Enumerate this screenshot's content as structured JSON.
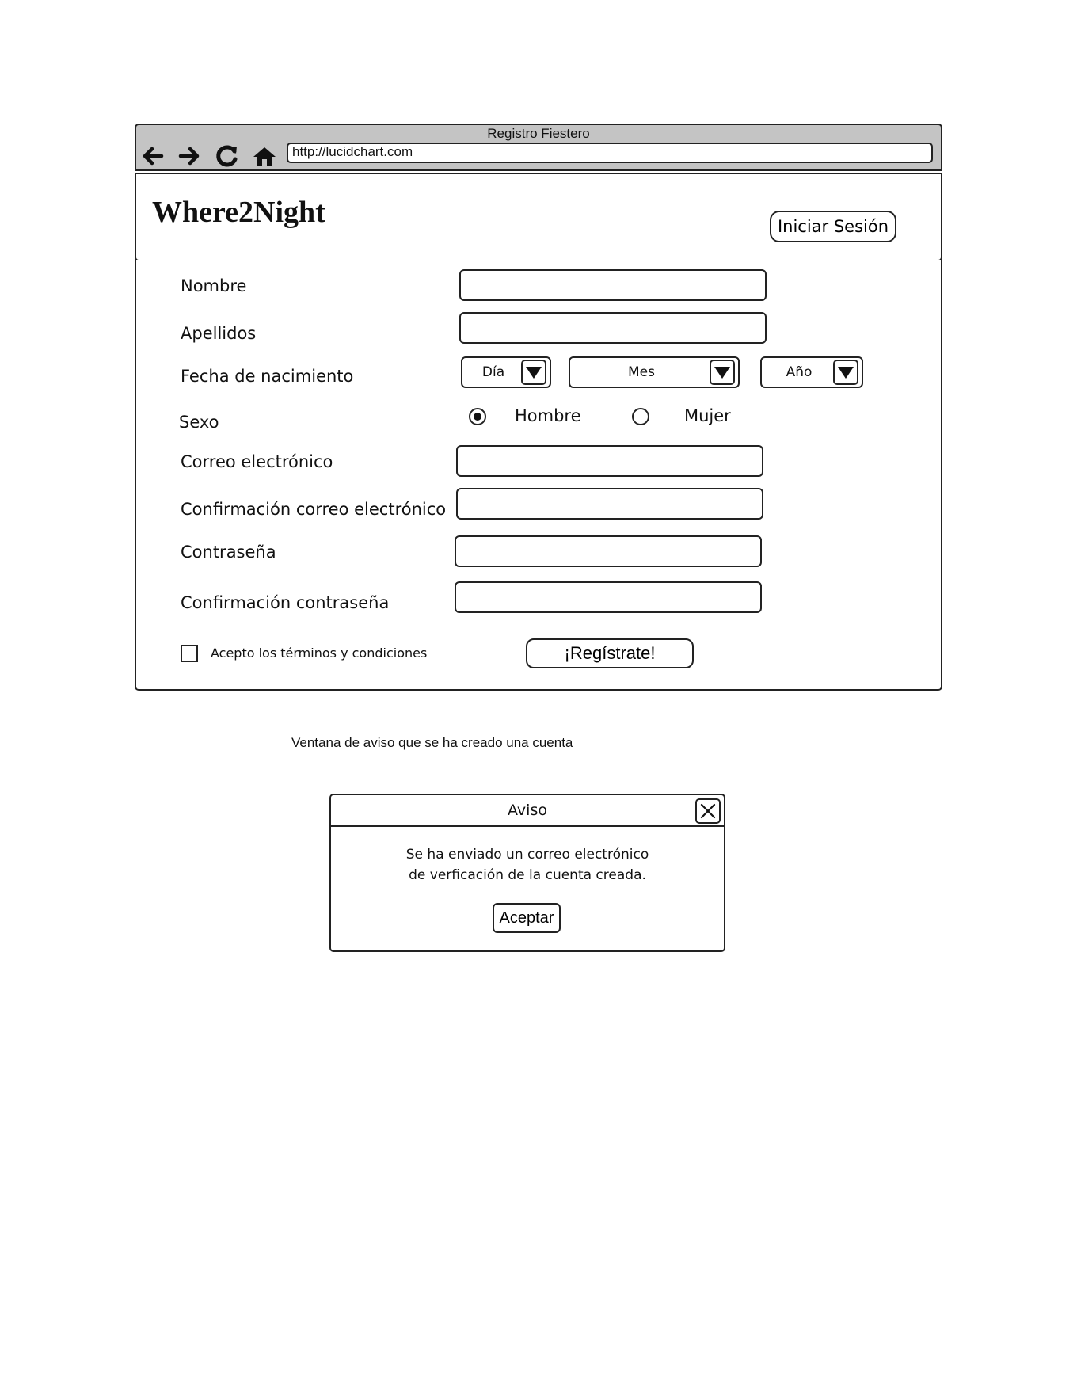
{
  "browser": {
    "window_title": "Registro Fiestero",
    "url": "http://lucidchart.com",
    "icons": [
      "back-arrow-icon",
      "forward-arrow-icon",
      "reload-icon",
      "home-icon"
    ]
  },
  "header": {
    "logo": "Where2Night",
    "login_label": "Iniciar Sesión"
  },
  "form": {
    "nombre_label": "Nombre",
    "apellidos_label": "Apellidos",
    "fecha_label": "Fecha de nacimiento",
    "dia_label": "Día",
    "mes_label": "Mes",
    "anio_label": "Año",
    "sexo_label": "Sexo",
    "hombre_label": "Hombre",
    "mujer_label": "Mujer",
    "selected_sexo": "Hombre",
    "correo_label": "Correo electrónico",
    "confirm_correo_label": "Confirmación correo electrónico",
    "password_label": "Contraseña",
    "confirm_password_label": "Confirmación contraseña",
    "terms_label": "Acepto los términos y condiciones",
    "terms_checked": false,
    "register_label": "¡Regístrate!"
  },
  "caption": "Ventana de aviso que se ha creado una cuenta",
  "dialog": {
    "title": "Aviso",
    "message_line1": "Se ha enviado un correo electrónico",
    "message_line2": "de verficación de la cuenta creada.",
    "accept_label": "Aceptar"
  }
}
